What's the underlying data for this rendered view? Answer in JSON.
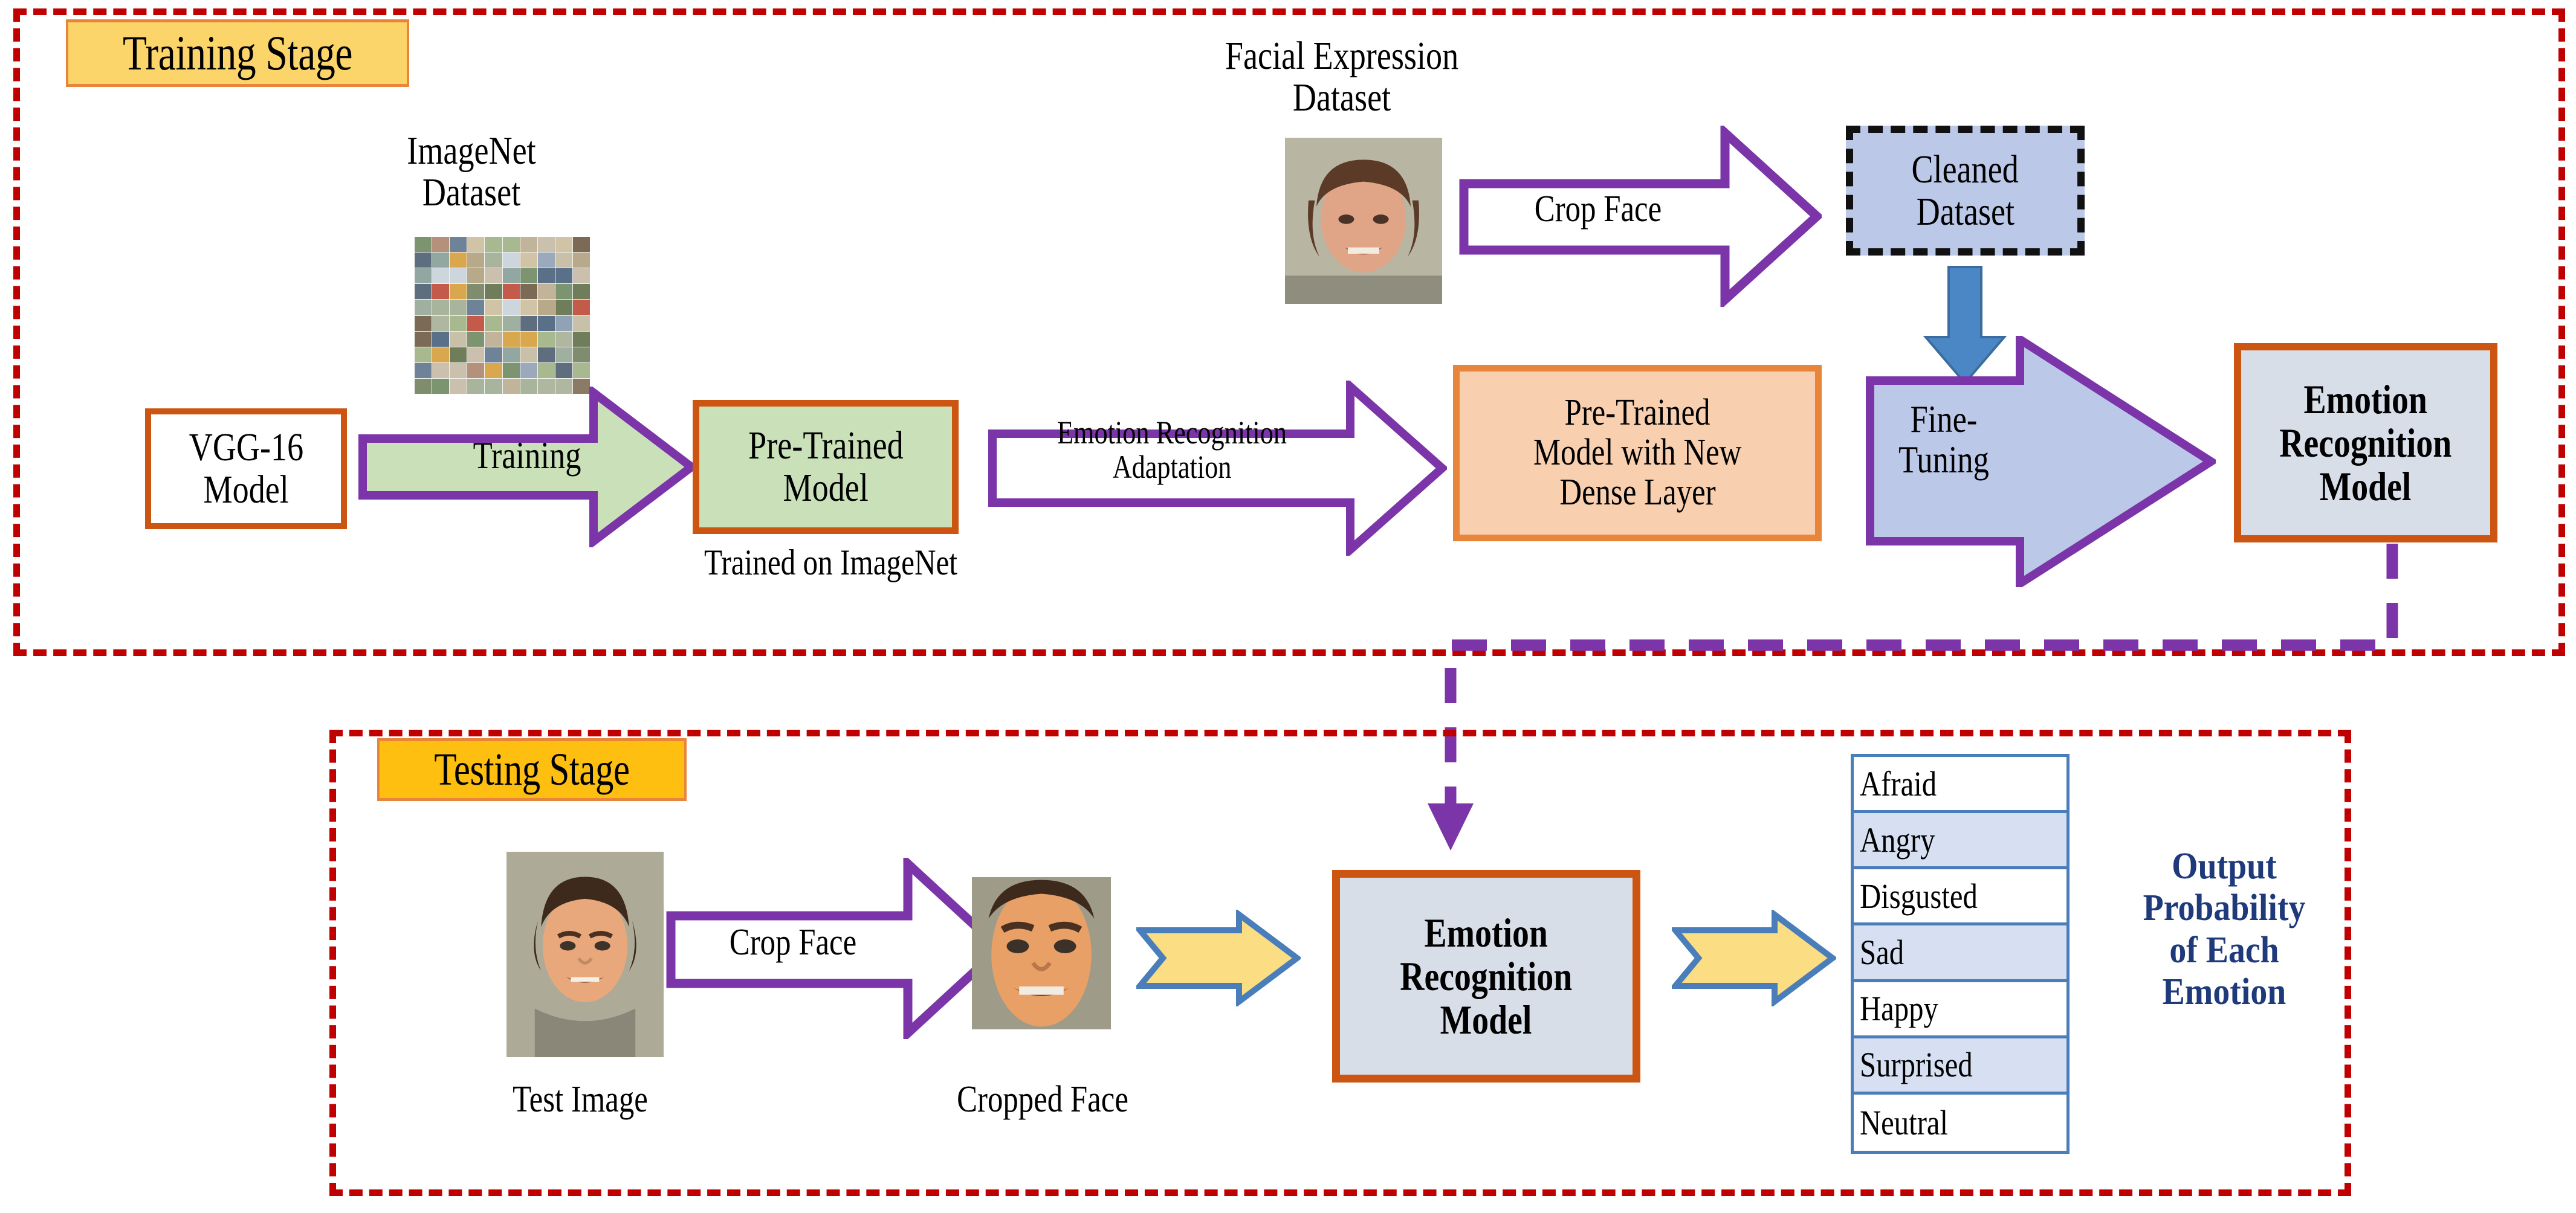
{
  "stages": {
    "training": {
      "title": "Training Stage"
    },
    "testing": {
      "title": "Testing Stage"
    }
  },
  "training_stage": {
    "imagenet_label": {
      "line1": "ImageNet",
      "line2": "Dataset"
    },
    "vgg_box": {
      "line1": "VGG-16",
      "line2": "Model"
    },
    "training_arrow": {
      "label": "Training"
    },
    "pretrained_box": {
      "line1": "Pre-Trained",
      "line2": "Model"
    },
    "trained_caption": "Trained on ImageNet",
    "adaptation_arrow": {
      "line1": "Emotion Recognition",
      "line2": "Adaptation"
    },
    "facial_label": {
      "line1": "Facial Expression",
      "line2": "Dataset"
    },
    "crop_face_arrow": {
      "label": "Crop Face"
    },
    "cleaned_box": {
      "line1": "Cleaned",
      "line2": "Dataset"
    },
    "new_dense_box": {
      "line1": "Pre-Trained",
      "line2": "Model with New",
      "line3": "Dense Layer"
    },
    "fine_tuning_arrow": {
      "line1": "Fine-",
      "line2": "Tuning"
    },
    "emotion_model_box": {
      "line1": "Emotion",
      "line2": "Recognition",
      "line3": "Model"
    }
  },
  "testing_stage": {
    "test_image_caption": "Test Image",
    "crop_face_arrow": {
      "label": "Crop Face"
    },
    "cropped_face_caption": "Cropped Face",
    "emotion_model_box": {
      "line1": "Emotion",
      "line2": "Recognition",
      "line3": "Model"
    },
    "emotions": [
      "Afraid",
      "Angry",
      "Disgusted",
      "Sad",
      "Happy",
      "Surprised",
      "Neutral"
    ],
    "output_label": {
      "line1": "Output",
      "line2": "Probability",
      "line3": "of Each",
      "line4": "Emotion"
    }
  },
  "colors": {
    "stage_border_red": "#c00000",
    "badge_training_fill": "#FBD46A",
    "badge_testing_fill": "#FFBF11",
    "badge_border_orange": "#E8853A",
    "box_border_orange": "#CC5511",
    "green_fill": "#C9E0B8",
    "peach_fill": "#F8D0B0",
    "lavender_fill": "#BCC8E8",
    "gray_blue_fill": "#D8DEE8",
    "purple_outline": "#7B35A8",
    "blue_arrow": "#4A87C4",
    "yellow_arrow_fill": "#FBDE84",
    "yellow_arrow_border": "#4A7EBB",
    "list_border_blue": "#4A7EBB",
    "list_alt_fill": "#D6E0F2",
    "output_text_navy": "#1F3A7A"
  },
  "icons": {
    "imagenet": "thumbnail-grid-icon",
    "female_face": "female-face-photo",
    "male_face": "male-face-photo",
    "cropped_male_face": "cropped-male-face-photo"
  }
}
